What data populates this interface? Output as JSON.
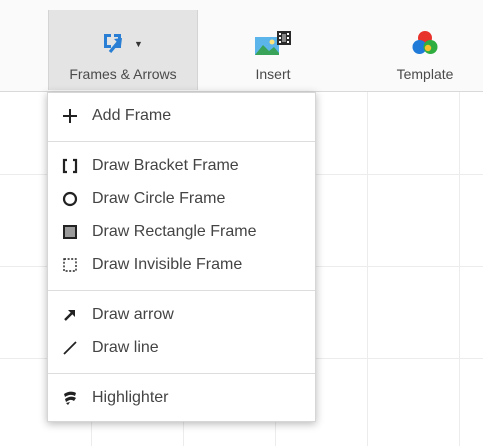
{
  "toolbar": {
    "buttons": [
      {
        "label": "Frames & Arrows",
        "icon": "frames-arrows-icon",
        "active": true
      },
      {
        "label": "Insert",
        "icon": "insert-image-icon"
      },
      {
        "label": "Template",
        "icon": "template-icon"
      }
    ]
  },
  "menu": {
    "items": [
      {
        "label": "Add Frame",
        "icon": "plus-icon"
      },
      {
        "label": "Draw Bracket Frame",
        "icon": "bracket-icon"
      },
      {
        "label": "Draw Circle Frame",
        "icon": "circle-icon"
      },
      {
        "label": "Draw Rectangle Frame",
        "icon": "rectangle-icon"
      },
      {
        "label": "Draw Invisible Frame",
        "icon": "dashed-rectangle-icon"
      },
      {
        "label": "Draw arrow",
        "icon": "arrow-icon"
      },
      {
        "label": "Draw line",
        "icon": "line-icon"
      },
      {
        "label": "Highlighter",
        "icon": "highlighter-icon"
      }
    ]
  },
  "colors": {
    "accent_blue": "#2a7fd4",
    "icon_dark": "#222222",
    "active_bg": "#e4e4e4"
  }
}
